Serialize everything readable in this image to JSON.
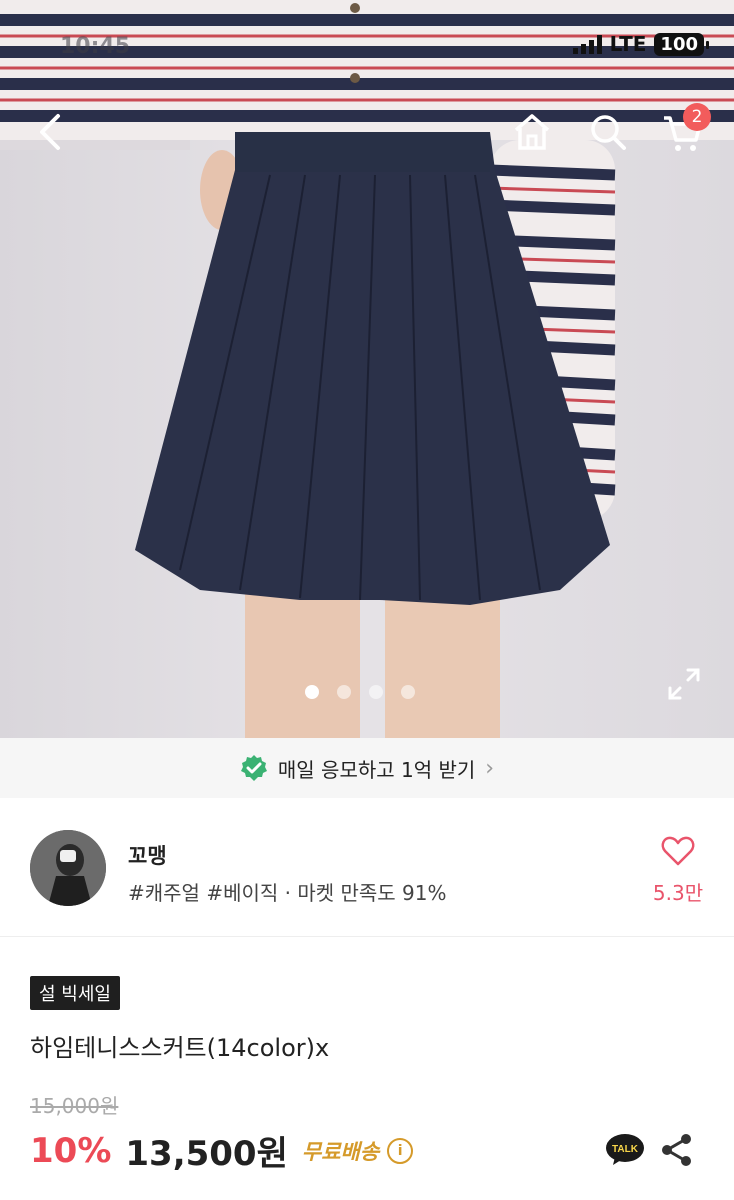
{
  "status_bar": {
    "time": "10:45",
    "network": "LTE",
    "battery": "100"
  },
  "header": {
    "cart_count": "2"
  },
  "gallery": {
    "image_count": 4,
    "active_index": 0
  },
  "promo": {
    "text": "매일 응모하고 1억 받기",
    "chevron": "›"
  },
  "seller": {
    "name": "꼬맹",
    "tags": "#캐주얼 #베이직 · 마켓 만족도 91%",
    "like_count": "5.3만"
  },
  "product": {
    "badge": "설 빅세일",
    "title": "하임테니스스커트(14color)x",
    "original_price": "15,000원",
    "discount": "10%",
    "price": "13,500원",
    "shipping": "무료배송",
    "info_glyph": "i"
  },
  "actions": {
    "talk_label": "TALK"
  },
  "colors": {
    "accent": "#ec4a56",
    "shipping": "#d59a2a",
    "promo_check": "#3bb273"
  }
}
